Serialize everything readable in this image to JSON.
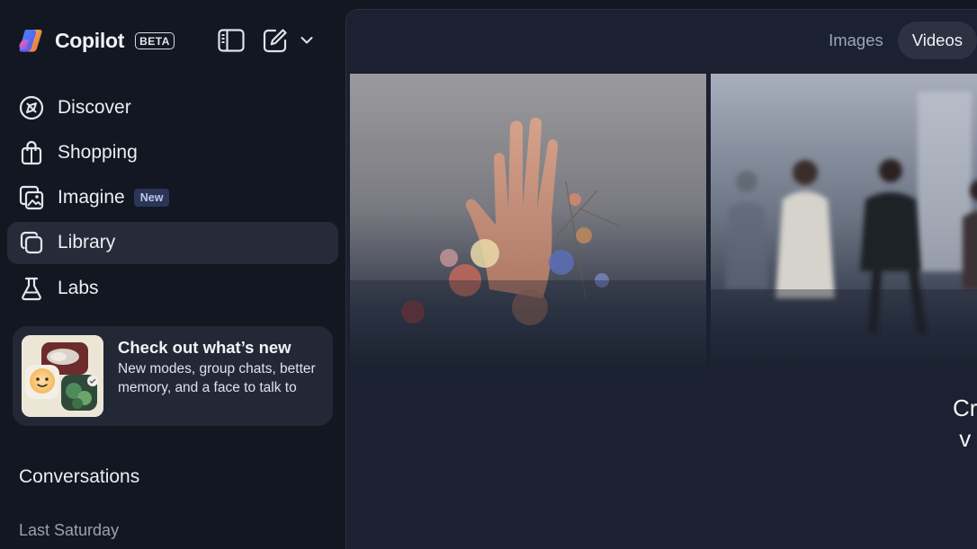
{
  "app": {
    "name": "Copilot",
    "badge": "BETA"
  },
  "nav": {
    "items": [
      {
        "label": "Discover",
        "icon": "compass-icon",
        "active": false
      },
      {
        "label": "Shopping",
        "icon": "shopping-bag-icon",
        "active": false
      },
      {
        "label": "Imagine",
        "icon": "image-sparkle-icon",
        "badge": "New",
        "active": false
      },
      {
        "label": "Library",
        "icon": "library-icon",
        "active": true
      },
      {
        "label": "Labs",
        "icon": "flask-icon",
        "active": false
      }
    ]
  },
  "promo": {
    "title": "Check out what’s new",
    "description": "New modes, group chats, better memory, and a face to talk to"
  },
  "conversations": {
    "title": "Conversations",
    "group": "Last Saturday"
  },
  "main": {
    "tabs": [
      {
        "label": "Images",
        "active": false
      },
      {
        "label": "Videos",
        "active": true
      }
    ],
    "hero_text": "Cr\n v"
  },
  "colors": {
    "background": "#121722",
    "panel": "#1b2130",
    "active_item": "#252b38",
    "new_badge_bg": "#2b3556"
  }
}
